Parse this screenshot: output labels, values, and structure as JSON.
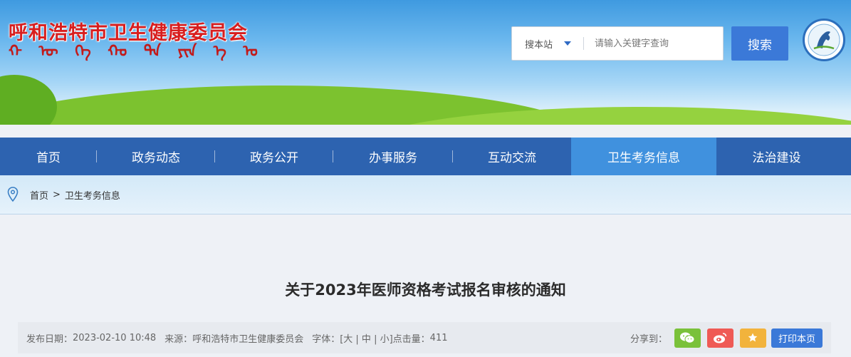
{
  "header": {
    "site_title": "呼和浩特市卫生健康委员会",
    "mongol_glyphs": [
      "ᠬ",
      "ᠥ",
      "ᠬᠡ",
      "ᠬᠣ",
      "ᠲᠠ",
      "ᠶᠢᠨ",
      "ᠡ",
      "ᠤ"
    ],
    "search": {
      "scope_label": "搜本站",
      "placeholder": "请输入关键字查询",
      "button_label": "搜索"
    }
  },
  "nav": {
    "items": [
      {
        "label": "首页"
      },
      {
        "label": "政务动态"
      },
      {
        "label": "政务公开"
      },
      {
        "label": "办事服务"
      },
      {
        "label": "互动交流"
      },
      {
        "label": "卫生考务信息",
        "active": true
      },
      {
        "label": "法治建设"
      }
    ]
  },
  "breadcrumb": {
    "home": "首页",
    "separator": ">",
    "current": "卫生考务信息"
  },
  "article": {
    "title": "关于2023年医师资格考试报名审核的通知",
    "meta": {
      "date_label": "发布日期：",
      "date": "2023-02-10 10:48",
      "source_label": "来源：",
      "source": "呼和浩特市卫生健康委员会",
      "font_label": "字体：",
      "font_options": "[大 | 中 | 小]",
      "hits_label": "点击量：",
      "hits": "411"
    },
    "share": {
      "label": "分享到：",
      "print_label": "打印本页"
    }
  },
  "colors": {
    "nav_bg": "#2d63b0",
    "nav_active": "#4091de",
    "accent": "#3b79d8",
    "title_red": "#d81e1e"
  }
}
